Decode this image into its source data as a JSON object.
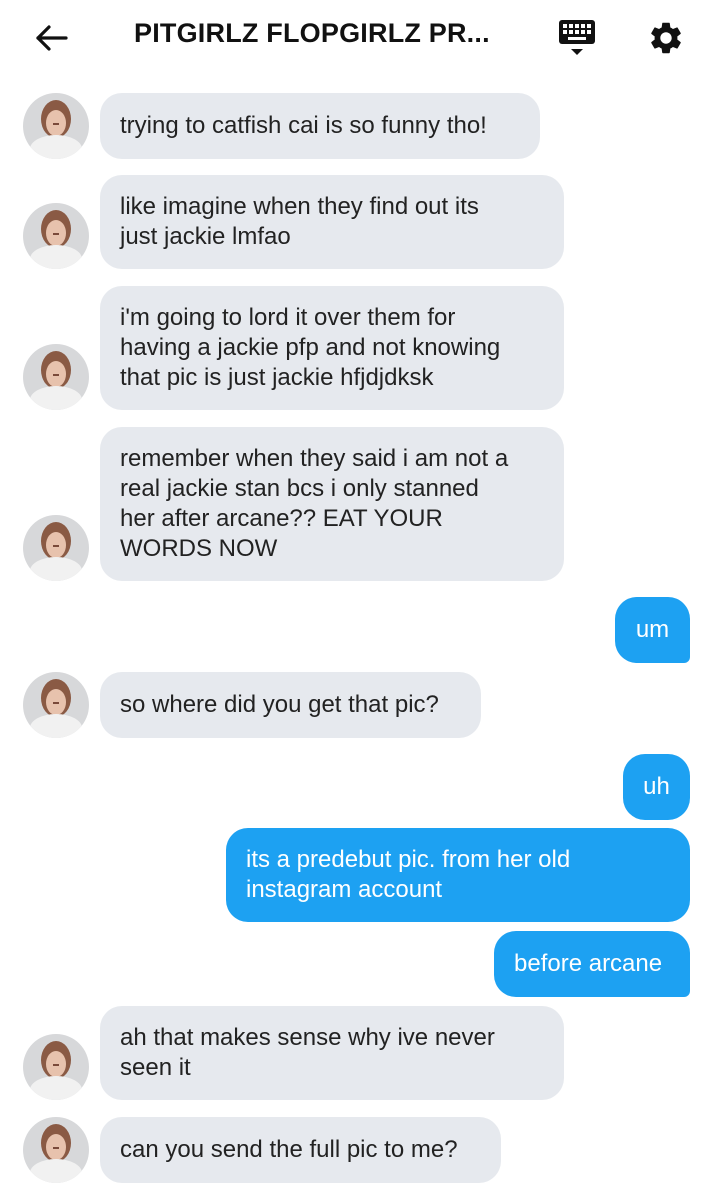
{
  "header": {
    "title": "PITGIRLZ FLOPGIRLZ PR...",
    "back_icon": "arrow-left-icon",
    "keyboard_icon": "keyboard-icon",
    "settings_icon": "gear-icon"
  },
  "colors": {
    "incoming_bubble": "#e6e9ee",
    "outgoing_bubble": "#1da1f2",
    "outgoing_text": "#ffffff"
  },
  "messages": [
    {
      "direction": "in",
      "text": "trying to catfish cai is so funny tho!"
    },
    {
      "direction": "in",
      "text": "like imagine when they find out its\njust jackie lmfao"
    },
    {
      "direction": "in",
      "text": "i'm going to lord it over them for\nhaving a jackie pfp and not knowing\nthat pic is just jackie hfjdjdksk"
    },
    {
      "direction": "in",
      "text": "remember when they said i am not a\nreal jackie stan bcs i only stanned\nher after arcane?? EAT YOUR\nWORDS NOW"
    },
    {
      "direction": "out",
      "text": "um"
    },
    {
      "direction": "in",
      "text": "so where did you get that pic?"
    },
    {
      "direction": "out",
      "text": "uh"
    },
    {
      "direction": "out",
      "text": "its a predebut pic. from her old\ninstagram account"
    },
    {
      "direction": "out",
      "text": "before arcane"
    },
    {
      "direction": "in",
      "text": "ah that makes sense why ive never\nseen it"
    },
    {
      "direction": "in",
      "text": "can you send the full pic to me?"
    }
  ]
}
